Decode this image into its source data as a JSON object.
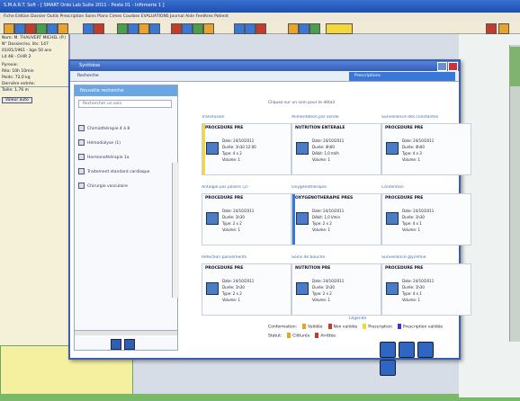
{
  "app": {
    "title": "S.M.A.R.T. Soft - [ SMART Ordo Lab Suite 2011 - Poste 01 - Infirmerie 1 ]",
    "menu": "Fiche  Edition  Dossier  Outils  Prescription  Soins  Plans  Cimes  Courbes  EVALUATIONS  Journal  Aide  Fenêtres  Patient"
  },
  "left_panel": {
    "lines": [
      "Nom: M. THAUVERT MICHEL (P.)",
      "N° Dossier/no. lits: 147",
      "01/01/1961 - âge 50 ans",
      "Lit 48 - CHIR 2",
      "Pyrexie:",
      "Réa: 10h 10min",
      "Poids: 72,0 kg",
      "Dernière entrée:",
      "Taille: 1,76 m"
    ],
    "button": "Valeur auto"
  },
  "dialog": {
    "title": "Synthèse",
    "tab_label": "Recherche",
    "blue_band": "Prescriptions",
    "top_note": "Cliquez sur un soin pour le détail"
  },
  "sidebar": {
    "header": "Nouvelle recherche",
    "search_placeholder": "Rechercher un soin",
    "items": [
      "Chimiothérapie 4 à 8",
      "Hémodialyse (1)",
      "Hormonothérapie 1a",
      "Traitement standard cardiaque",
      "Chirurgie vasculaire"
    ]
  },
  "cards": [
    {
      "title": "Transfusion",
      "id": "PROCEDURE PRE",
      "lines": [
        "Date: 24/10/2011",
        "Durée: 1h30 12:00",
        "Type: 4 x 2",
        "Volume: 1"
      ],
      "color": "#f2d83a"
    },
    {
      "title": "Alimentation par sonde",
      "id": "NUTRITION ENTERALE",
      "lines": [
        "Date: 24/10/2011",
        "Durée: 4h00",
        "Débit: 1,0 ml/h",
        "Volume: 1"
      ],
      "color": ""
    },
    {
      "title": "Surveillance des constantes",
      "id": "PROCEDURE PRE",
      "lines": [
        "Date: 24/10/2011",
        "Durée: 4h00",
        "Type: 4 x 3",
        "Volume: 1"
      ],
      "color": ""
    },
    {
      "title": "Antalgie par paliers (2)",
      "id": "PROCEDURE PRE",
      "lines": [
        "Date: 24/10/2011",
        "Durée: 1h30",
        "Type: 2 x 2",
        "Volume: 1"
      ],
      "color": ""
    },
    {
      "title": "Oxygénothérapie",
      "id": "OXYGENOTHERAPIE PRES",
      "lines": [
        "Date: 24/10/2011",
        "Débit: 1,0 l/min",
        "Type: 2 x 2",
        "Volume: 1"
      ],
      "color": "#3a78d8"
    },
    {
      "title": "Contention",
      "id": "PROCEDURE PRE",
      "lines": [
        "Date: 24/10/2011",
        "Durée: 1h30",
        "Type: 4 x 1",
        "Volume: 1"
      ],
      "color": ""
    },
    {
      "title": "Réfection pansements",
      "id": "PROCEDURE PRE",
      "lines": [
        "Date: 24/10/2011",
        "Durée: 1h30",
        "Type: 2 x 2",
        "Volume: 1"
      ],
      "color": ""
    },
    {
      "title": "Soins de bouche",
      "id": "NUTRITION PRE",
      "lines": [
        "Date: 24/10/2011",
        "Durée: 1h30",
        "Type: 2 x 2",
        "Volume: 1"
      ],
      "color": ""
    },
    {
      "title": "Surveillance glycémie",
      "id": "PROCEDURE PRE",
      "lines": [
        "Date: 24/10/2011",
        "Durée: 1h30",
        "Type: 4 x 1",
        "Volume: 1"
      ],
      "color": ""
    }
  ],
  "legend": {
    "title": "Légende",
    "row1_label": "Conformation:",
    "row1_items": [
      {
        "label": "Validée",
        "color": "#e9a32a"
      },
      {
        "label": "Non validée",
        "color": "#c63a2a"
      },
      {
        "label": "Prescription",
        "color": "#f2d83a"
      },
      {
        "label": "Prescription validée",
        "color": "#3a3ad0"
      }
    ],
    "row2_label": "Statut:",
    "row2_items": [
      {
        "label": "Clôturée",
        "color": "#e9a32a"
      },
      {
        "label": "Arrêtée",
        "color": "#c63a2a"
      }
    ]
  },
  "icons": {
    "dialog_footer": [
      "rss-icon",
      "tools-icon",
      "help-icon",
      "refresh-icon"
    ],
    "sidebar_footer": [
      "prev-icon",
      "next-icon"
    ]
  }
}
